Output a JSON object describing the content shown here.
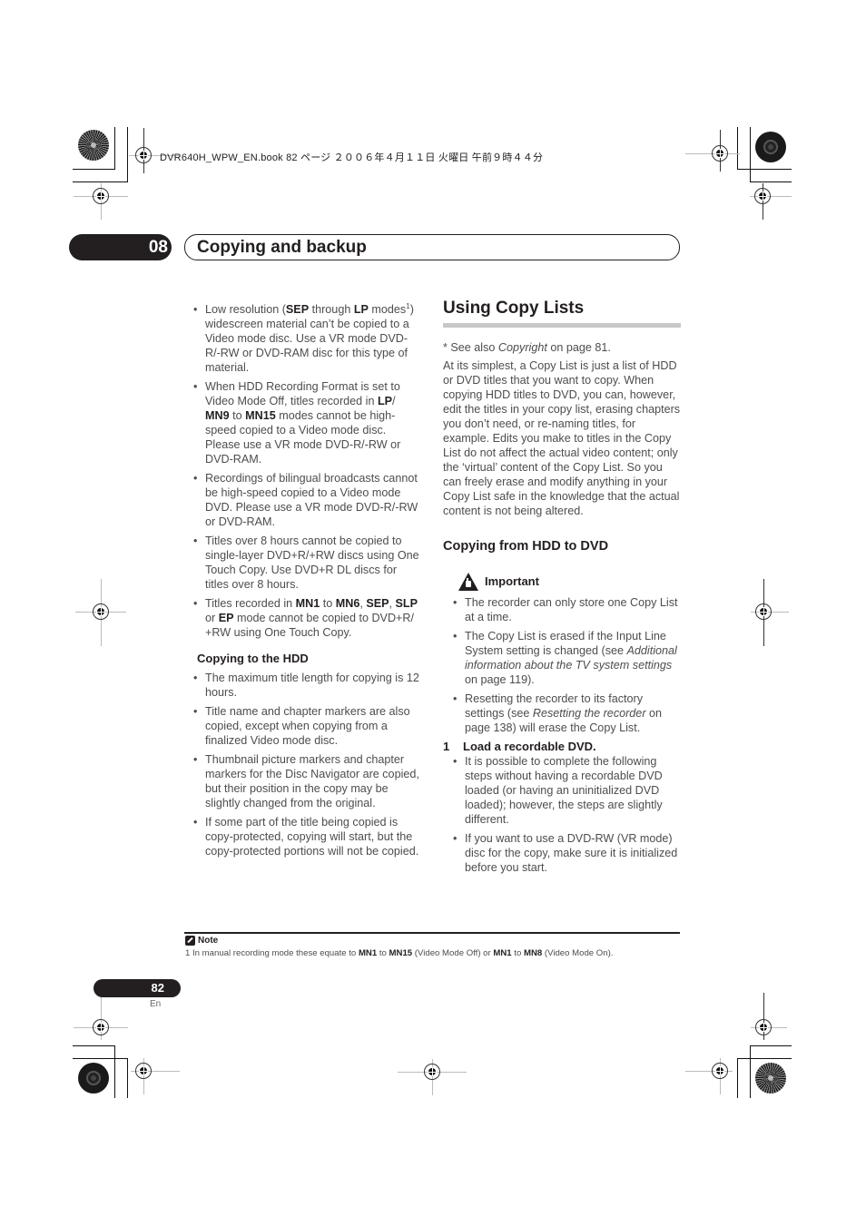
{
  "print_header": "DVR640H_WPW_EN.book  82 ページ  ２００６年４月１１日  火曜日  午前９時４４分",
  "chapter": {
    "number": "08",
    "title": "Copying and backup"
  },
  "left_column": {
    "bullets_top": [
      {
        "parts": [
          {
            "t": "Low resolution ("
          },
          {
            "t": "SEP",
            "b": true
          },
          {
            "t": " through "
          },
          {
            "t": "LP",
            "b": true
          },
          {
            "t": " modes"
          },
          {
            "t": "1",
            "sup": true
          },
          {
            "t": ") widescreen material can’t be copied to a Video mode disc. Use a VR mode DVD-R/-RW or DVD-RAM disc for this type of material."
          }
        ]
      },
      {
        "parts": [
          {
            "t": "When HDD Recording Format is set to Video Mode Off, titles recorded in "
          },
          {
            "t": "LP",
            "b": true
          },
          {
            "t": "/ "
          },
          {
            "t": "MN9",
            "b": true
          },
          {
            "t": " to "
          },
          {
            "t": "MN15",
            "b": true
          },
          {
            "t": " modes cannot be high-speed copied to a Video mode disc. Please use a VR mode DVD-R/-RW or DVD-RAM."
          }
        ]
      },
      {
        "parts": [
          {
            "t": "Recordings of bilingual broadcasts cannot be high-speed copied to a Video mode DVD. Please use a VR mode DVD-R/-RW or DVD-RAM."
          }
        ]
      },
      {
        "parts": [
          {
            "t": "Titles over 8 hours cannot be copied to single-layer DVD+R/+RW discs using One Touch Copy. Use DVD+R DL discs for titles over 8 hours."
          }
        ]
      },
      {
        "parts": [
          {
            "t": "Titles recorded in "
          },
          {
            "t": "MN1",
            "b": true
          },
          {
            "t": " to "
          },
          {
            "t": "MN6",
            "b": true
          },
          {
            "t": ", "
          },
          {
            "t": "SEP",
            "b": true
          },
          {
            "t": ", "
          },
          {
            "t": "SLP",
            "b": true
          },
          {
            "t": " or "
          },
          {
            "t": "EP",
            "b": true
          },
          {
            "t": " mode cannot be copied to DVD+R/ +RW using One Touch Copy."
          }
        ]
      }
    ],
    "subheading": "Copying to the HDD",
    "bullets_hdd": [
      {
        "parts": [
          {
            "t": "The maximum title length for copying is 12 hours."
          }
        ]
      },
      {
        "parts": [
          {
            "t": "Title name and chapter markers are also copied, except when copying from a finalized Video mode disc."
          }
        ]
      },
      {
        "parts": [
          {
            "t": "Thumbnail picture markers and chapter markers for the Disc Navigator are copied, but their position in the copy may be slightly changed from the original."
          }
        ]
      },
      {
        "parts": [
          {
            "t": "If some part of the title being copied is copy-protected, copying will start, but the copy-protected portions will not be copied."
          }
        ]
      }
    ]
  },
  "right_column": {
    "section_title": "Using Copy Lists",
    "see_also": {
      "parts": [
        {
          "t": "* See also "
        },
        {
          "t": "Copyright",
          "i": true
        },
        {
          "t": " on page 81."
        }
      ]
    },
    "intro": "At its simplest, a Copy List is just a list of HDD or DVD titles that you want to copy. When copying HDD titles to DVD, you can, however, edit the titles in your copy list, erasing chapters you don’t need, or re-naming titles, for example. Edits you make to titles in the Copy List do not affect the actual video content; only the ‘virtual’ content of the Copy List. So you can freely erase and modify anything in your Copy List safe in the knowledge that the actual content is not being altered.",
    "subsection_title": "Copying from HDD to DVD",
    "important_label": "Important",
    "important_bullets": [
      {
        "parts": [
          {
            "t": "The recorder can only store one Copy List at a time."
          }
        ]
      },
      {
        "parts": [
          {
            "t": "The Copy List is erased if the Input Line System setting is changed (see "
          },
          {
            "t": "Additional information about the TV system settings",
            "i": true
          },
          {
            "t": " on page 119)."
          }
        ]
      },
      {
        "parts": [
          {
            "t": "Resetting the recorder to its factory settings (see "
          },
          {
            "t": "Resetting the recorder",
            "i": true
          },
          {
            "t": " on page 138) will erase the Copy List."
          }
        ]
      }
    ],
    "step": {
      "number": "1",
      "label": "Load a recordable DVD."
    },
    "step_bullets": [
      {
        "parts": [
          {
            "t": "It is possible to complete the following steps without having a recordable DVD loaded (or having an uninitialized DVD loaded); however, the steps are slightly different."
          }
        ]
      },
      {
        "parts": [
          {
            "t": "If you want to use a DVD-RW (VR mode) disc for the copy, make sure it is initialized before you start."
          }
        ]
      }
    ]
  },
  "note": {
    "label": "Note",
    "parts": [
      {
        "t": "1 In manual recording mode these equate to "
      },
      {
        "t": "MN1",
        "b": true
      },
      {
        "t": " to "
      },
      {
        "t": "MN15",
        "b": true
      },
      {
        "t": " (Video Mode Off) or "
      },
      {
        "t": "MN1",
        "b": true
      },
      {
        "t": " to "
      },
      {
        "t": "MN8",
        "b": true
      },
      {
        "t": " (Video Mode On)."
      }
    ]
  },
  "footer": {
    "page_number": "82",
    "language": "En"
  },
  "icons": {
    "important": "warning-hand-icon",
    "note": "pencil-note-icon"
  }
}
